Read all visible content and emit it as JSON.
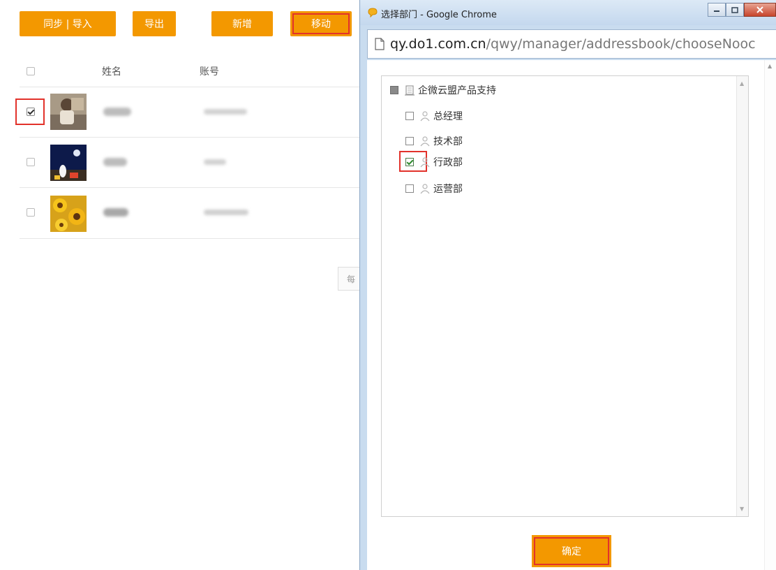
{
  "toolbar": {
    "sync_import": "同步 | 导入",
    "export": "导出",
    "add": "新增",
    "move": "移动"
  },
  "table": {
    "col_name": "姓名",
    "col_account": "账号",
    "rows": [
      {
        "checked": true,
        "avatar": "photo-child"
      },
      {
        "checked": false,
        "avatar": "photo-night"
      },
      {
        "checked": false,
        "avatar": "photo-sunflower"
      }
    ]
  },
  "pager_text": "每",
  "popup": {
    "title": "选择部门 - Google Chrome",
    "url_host": "qy.do1.com.cn",
    "url_path": "/qwy/manager/addressbook/chooseNooc",
    "tree": {
      "root": {
        "label": "企微云盟产品支持",
        "state": "partial"
      },
      "children": [
        {
          "label": "总经理",
          "checked": false
        },
        {
          "label": "技术部",
          "checked": false
        },
        {
          "label": "行政部",
          "checked": true
        },
        {
          "label": "运营部",
          "checked": false
        }
      ]
    },
    "confirm_label": "确定"
  },
  "colors": {
    "brand_orange": "#f39800",
    "highlight_red": "#e2322b",
    "window_frame": "#c9dcef"
  }
}
